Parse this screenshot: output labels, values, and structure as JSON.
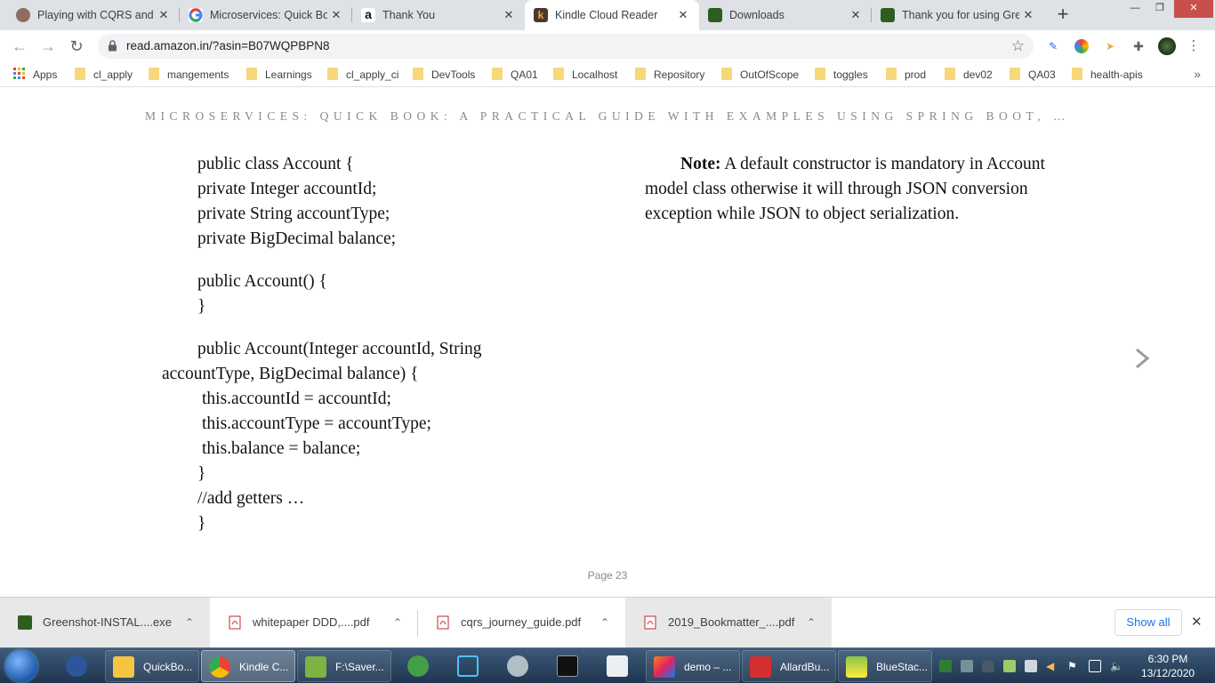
{
  "browser": {
    "tabs": [
      {
        "title": "Playing with CQRS and E",
        "favicon_color": "#8d6e63",
        "active": false
      },
      {
        "title": "Microservices: Quick Boo",
        "favicon_color": "#4285f4",
        "active": false
      },
      {
        "title": "Thank You",
        "favicon_color": "#ff9900",
        "active": false
      },
      {
        "title": "Kindle Cloud Reader",
        "favicon_color": "#4a3a2a",
        "active": true
      },
      {
        "title": "Downloads",
        "favicon_color": "#3a7d2c",
        "active": false
      },
      {
        "title": "Thank you for using Gre",
        "favicon_color": "#3a7d2c",
        "active": false
      }
    ],
    "new_tab_label": "+",
    "window_controls": {
      "minimize": "—",
      "restore": "❐",
      "close": "✕"
    },
    "url": "read.amazon.in/?asin=B07WQPBPN8",
    "bookmarks": [
      "cl_apply",
      "mangements",
      "Learnings",
      "cl_apply_ci",
      "DevTools",
      "QA01",
      "Localhost",
      "Repository",
      "OutOfScope",
      "toggles",
      "prod",
      "dev02",
      "QA03",
      "health-apis"
    ],
    "apps_label": "Apps",
    "more_bookmarks": "»"
  },
  "reader": {
    "book_title": "MICROSERVICES: QUICK BOOK: A PRACTICAL GUIDE WITH EXAMPLES USING SPRING BOOT, …",
    "code_lines": {
      "l1": "public class Account {",
      "l2": "private Integer accountId;",
      "l3": "private String accountType;",
      "l4": "private BigDecimal balance;",
      "l5": "public Account() {",
      "l6": "}",
      "l7": "public Account(Integer accountId, String",
      "l8": "accountType, BigDecimal balance) {",
      "l9": "this.accountId = accountId;",
      "l10": "this.accountType = accountType;",
      "l11": "this.balance = balance;",
      "l12": "}",
      "l13": "//add getters …",
      "l14": "}"
    },
    "note_label": "Note:",
    "note_text": " A default constructor is mandatory in Account model class otherwise it will through JSON conversion exception while JSON to object serialization.",
    "page_label": "Page 23"
  },
  "downloads": {
    "items": [
      {
        "name": "Greenshot-INSTAL....exe",
        "icon": "greenshot-icon"
      },
      {
        "name": "whitepaper DDD,....pdf",
        "icon": "pdf-icon"
      },
      {
        "name": "cqrs_journey_guide.pdf",
        "icon": "pdf-icon"
      },
      {
        "name": "2019_Bookmatter_....pdf",
        "icon": "pdf-icon"
      }
    ],
    "show_all": "Show all",
    "close": "✕"
  },
  "taskbar": {
    "buttons": [
      {
        "label": "QuickBo...",
        "icon_color": "#f5c542"
      },
      {
        "label": "Kindle C...",
        "icon_color": "#4285f4",
        "active": true
      },
      {
        "label": "F:\\Saver...",
        "icon_color": "#7cb342"
      },
      {
        "label": "demo – ...",
        "icon_color": "#e0245e"
      },
      {
        "label": "AllardBu...",
        "icon_color": "#d32f2f"
      },
      {
        "label": "BlueStac...",
        "icon_color": "#8bc34a"
      }
    ],
    "time": "6:30 PM",
    "date": "13/12/2020"
  }
}
